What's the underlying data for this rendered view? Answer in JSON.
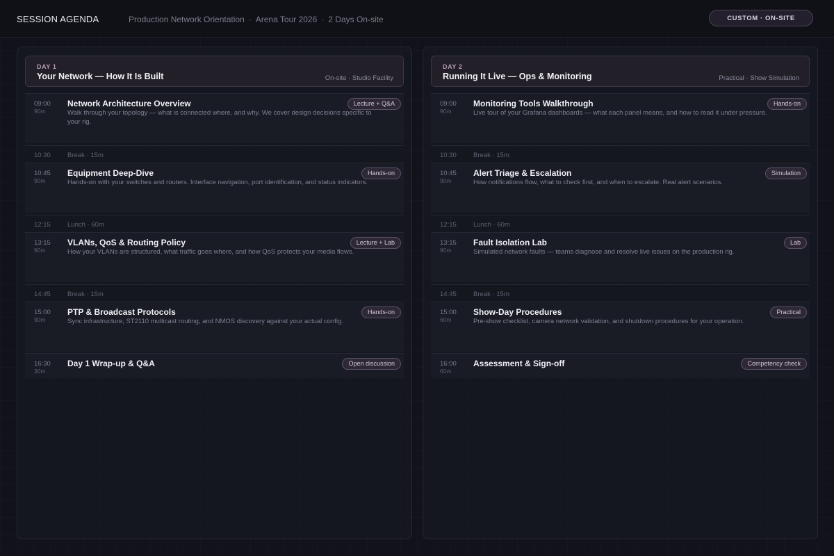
{
  "header": {
    "title": "SESSION AGENDA",
    "breadcrumbs": [
      "Production Network Orientation",
      "Arena Tour 2026",
      "2 Days On-site"
    ],
    "badge": "CUSTOM · ON-SITE"
  },
  "days": [
    {
      "label": "DAY 1",
      "title": "Your Network — How It Is Built",
      "meta": "On-site · Studio Facility",
      "sessions": [
        {
          "time": "09:00",
          "duration": "90m",
          "title": "Network Architecture Overview",
          "description": "Walk through your topology — what is connected where, and why. We cover design decisions specific to your rig.",
          "tag": "Lecture + Q&A"
        },
        {
          "time": "10:30",
          "label": "Break · 15m"
        },
        {
          "time": "10:45",
          "duration": "90m",
          "title": "Equipment Deep-Dive",
          "description": "Hands-on with your switches and routers. Interface navigation, port identification, and status indicators.",
          "tag": "Hands-on"
        },
        {
          "time": "12:15",
          "label": "Lunch · 60m"
        },
        {
          "time": "13:15",
          "duration": "90m",
          "title": "VLANs, QoS & Routing Policy",
          "description": "How your VLANs are structured, what traffic goes where, and how QoS protects your media flows.",
          "tag": "Lecture + Lab"
        },
        {
          "time": "14:45",
          "label": "Break · 15m"
        },
        {
          "time": "15:00",
          "duration": "90m",
          "title": "PTP & Broadcast Protocols",
          "description": "Sync infrastructure, ST2110 multicast routing, and NMOS discovery against your actual config.",
          "tag": "Hands-on"
        },
        {
          "time": "16:30",
          "duration": "30m",
          "title": "Day 1 Wrap-up & Q&A",
          "description": "",
          "tag": "Open discussion"
        }
      ]
    },
    {
      "label": "DAY 2",
      "title": "Running It Live — Ops & Monitoring",
      "meta": "Practical · Show Simulation",
      "sessions": [
        {
          "time": "09:00",
          "duration": "90m",
          "title": "Monitoring Tools Walkthrough",
          "description": "Live tour of your Grafana dashboards — what each panel means, and how to read it under pressure.",
          "tag": "Hands-on"
        },
        {
          "time": "10:30",
          "label": "Break · 15m"
        },
        {
          "time": "10:45",
          "duration": "90m",
          "title": "Alert Triage & Escalation",
          "description": "How notifications flow, what to check first, and when to escalate. Real alert scenarios.",
          "tag": "Simulation"
        },
        {
          "time": "12:15",
          "label": "Lunch · 60m"
        },
        {
          "time": "13:15",
          "duration": "90m",
          "title": "Fault Isolation Lab",
          "description": "Simulated network faults — teams diagnose and resolve live issues on the production rig.",
          "tag": "Lab"
        },
        {
          "time": "14:45",
          "label": "Break · 15m"
        },
        {
          "time": "15:00",
          "duration": "60m",
          "title": "Show-Day Procedures",
          "description": "Pre-show checklist, camera network validation, and shutdown procedures for your operation.",
          "tag": "Practical"
        },
        {
          "time": "16:00",
          "duration": "60m",
          "title": "Assessment & Sign-off",
          "description": "",
          "tag": "Competency check"
        }
      ]
    }
  ]
}
